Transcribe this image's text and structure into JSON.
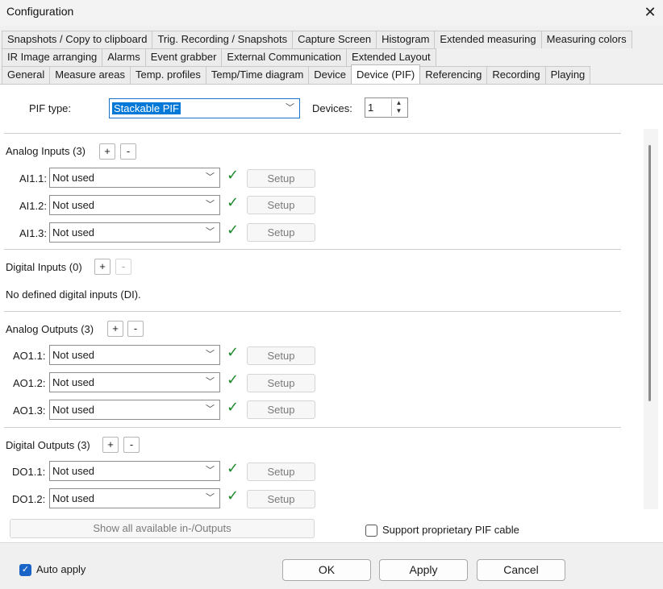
{
  "window": {
    "title": "Configuration"
  },
  "tabs": {
    "row1": [
      "Snapshots / Copy to clipboard",
      "Trig. Recording / Snapshots",
      "Capture Screen",
      "Histogram",
      "Extended measuring",
      "Measuring colors"
    ],
    "row2": [
      "IR Image arranging",
      "Alarms",
      "Event grabber",
      "External Communication",
      "Extended Layout"
    ],
    "row3": [
      "General",
      "Measure areas",
      "Temp. profiles",
      "Temp/Time diagram",
      "Device",
      "Device (PIF)",
      "Referencing",
      "Recording",
      "Playing"
    ],
    "active": "Device (PIF)"
  },
  "pif": {
    "type_label": "PIF type:",
    "type_value": "Stackable PIF",
    "devices_label": "Devices:",
    "devices_value": "1"
  },
  "analog_inputs": {
    "header": "Analog Inputs (3)",
    "rows": [
      {
        "label": "AI1.1:",
        "value": "Not used",
        "setup": "Setup"
      },
      {
        "label": "AI1.2:",
        "value": "Not used",
        "setup": "Setup"
      },
      {
        "label": "AI1.3:",
        "value": "Not used",
        "setup": "Setup"
      }
    ]
  },
  "digital_inputs": {
    "header": "Digital Inputs (0)",
    "empty_text": "No defined digital inputs (DI)."
  },
  "analog_outputs": {
    "header": "Analog Outputs (3)",
    "rows": [
      {
        "label": "AO1.1:",
        "value": "Not used",
        "setup": "Setup"
      },
      {
        "label": "AO1.2:",
        "value": "Not used",
        "setup": "Setup"
      },
      {
        "label": "AO1.3:",
        "value": "Not used",
        "setup": "Setup"
      }
    ]
  },
  "digital_outputs": {
    "header": "Digital Outputs (3)",
    "rows": [
      {
        "label": "DO1.1:",
        "value": "Not used",
        "setup": "Setup"
      },
      {
        "label": "DO1.2:",
        "value": "Not used",
        "setup": "Setup"
      }
    ]
  },
  "show_all_label": "Show all available in-/Outputs",
  "support_cable_label": "Support proprietary PIF cable",
  "support_cable_checked": false,
  "footer": {
    "auto_apply_label": "Auto apply",
    "auto_apply_checked": true,
    "ok": "OK",
    "apply": "Apply",
    "cancel": "Cancel"
  },
  "colors": {
    "accent": "#1a63c7",
    "check_green": "#1e8a2c"
  }
}
